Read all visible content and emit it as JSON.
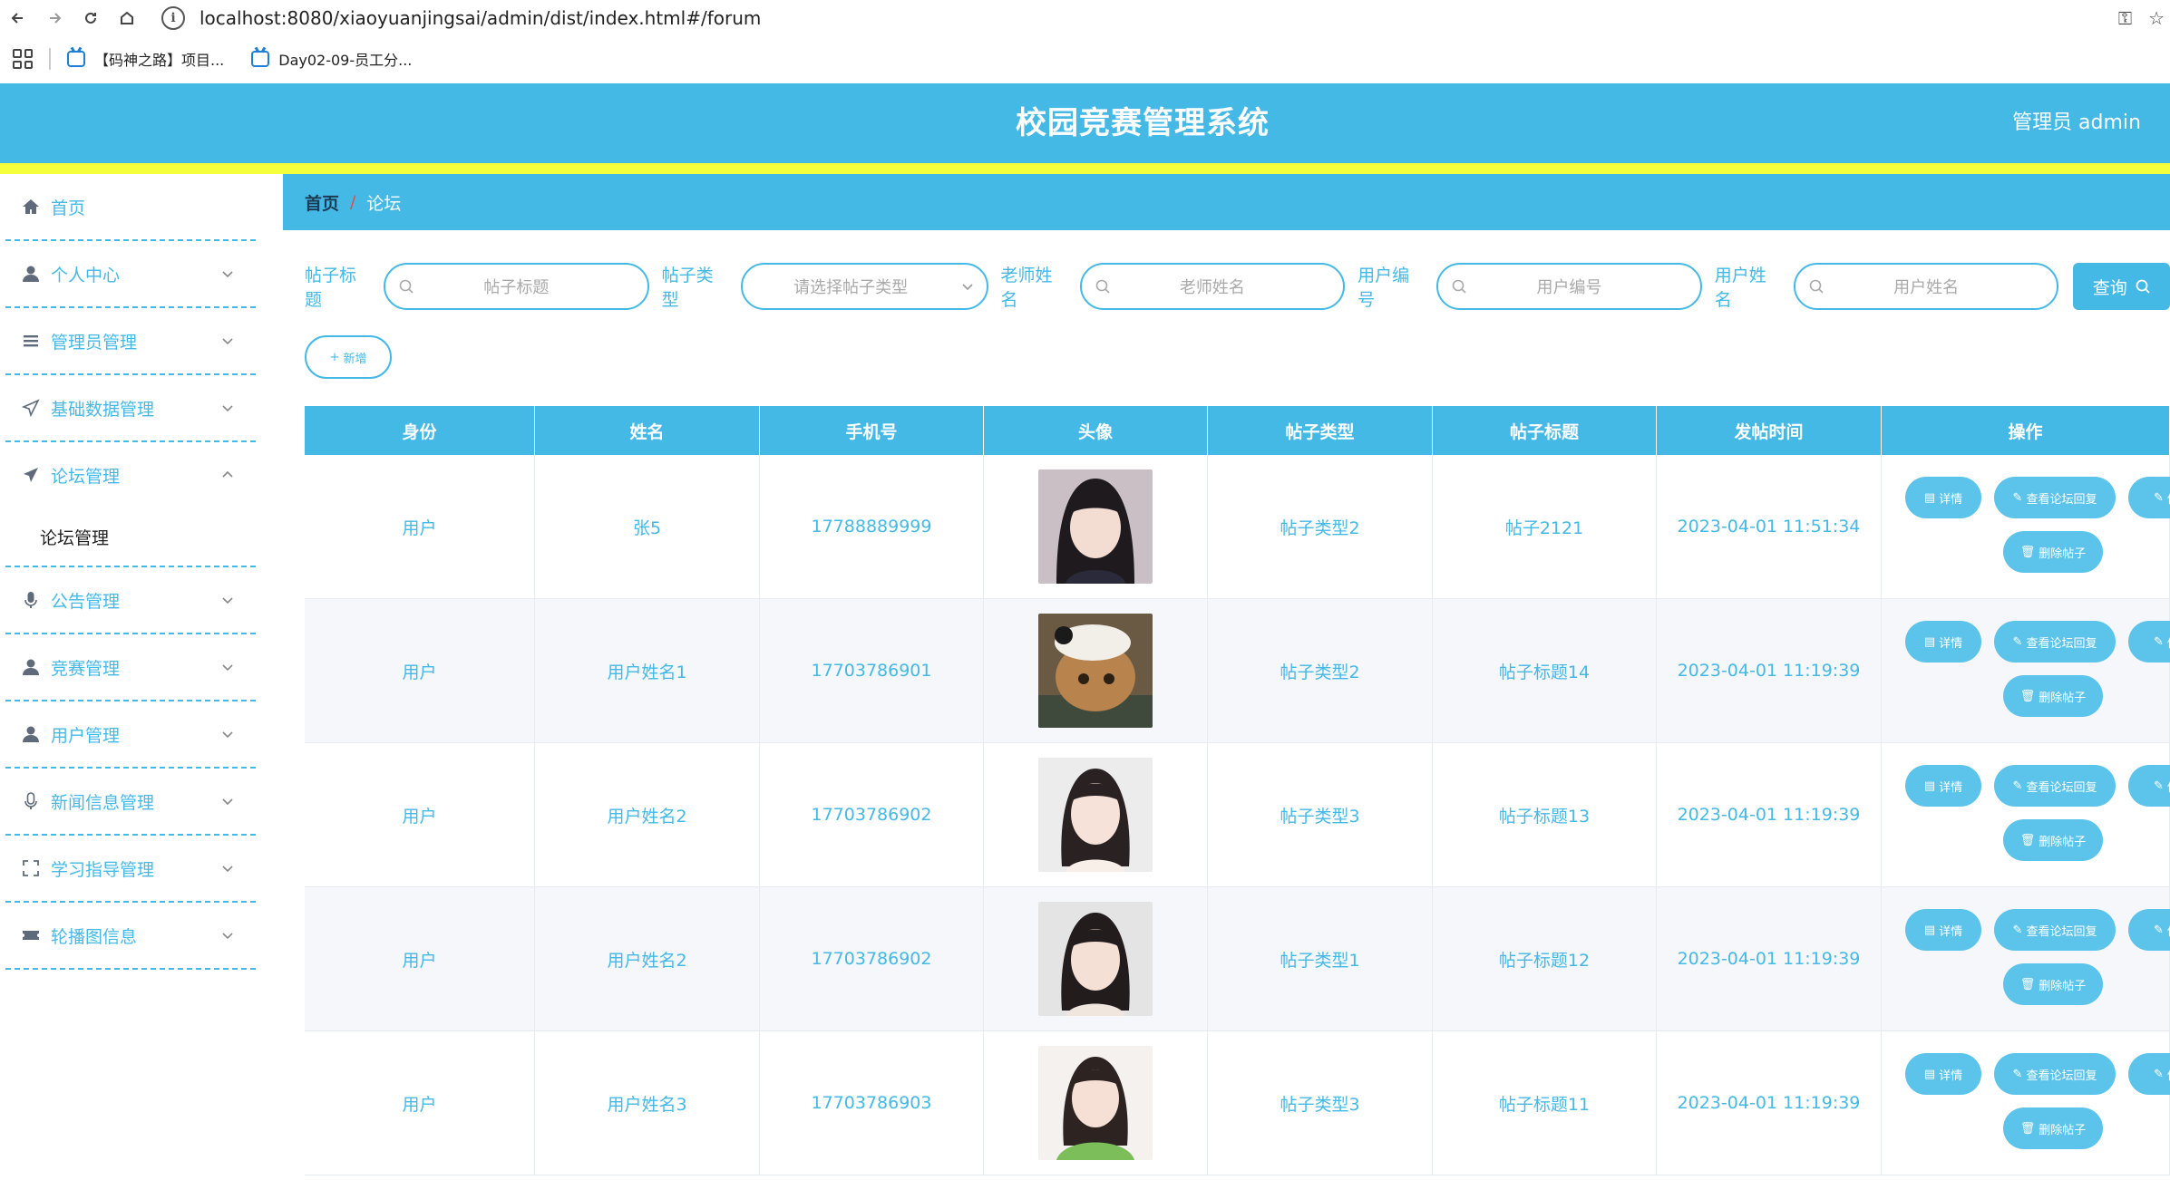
{
  "browser": {
    "url": "localhost:8080/xiaoyuanjingsai/admin/dist/index.html#/forum",
    "bookmarks": [
      "【码神之路】项目...",
      "Day02-09-员工分..."
    ]
  },
  "header": {
    "title": "校园竞赛管理系统",
    "user": "管理员 admin"
  },
  "sidebar": {
    "items": [
      {
        "label": "首页",
        "icon": "home-icon"
      },
      {
        "label": "个人中心",
        "icon": "user-icon"
      },
      {
        "label": "管理员管理",
        "icon": "list-icon"
      },
      {
        "label": "基础数据管理",
        "icon": "send-icon"
      },
      {
        "label": "论坛管理",
        "icon": "send-icon"
      },
      {
        "label": "公告管理",
        "icon": "mic-icon"
      },
      {
        "label": "竞赛管理",
        "icon": "user-icon"
      },
      {
        "label": "用户管理",
        "icon": "user-icon"
      },
      {
        "label": "新闻信息管理",
        "icon": "mic-icon"
      },
      {
        "label": "学习指导管理",
        "icon": "fullscreen-icon"
      },
      {
        "label": "轮播图信息",
        "icon": "ticket-icon"
      }
    ],
    "submenu": "论坛管理"
  },
  "breadcrumb": {
    "home": "首页",
    "sep": "/",
    "current": "论坛"
  },
  "search": {
    "title_label": "帖子标题",
    "title_placeholder": "帖子标题",
    "type_label": "帖子类型",
    "type_placeholder": "请选择帖子类型",
    "teacher_label": "老师姓名",
    "teacher_placeholder": "老师姓名",
    "userno_label": "用户编号",
    "userno_placeholder": "用户编号",
    "username_label": "用户姓名",
    "username_placeholder": "用户姓名",
    "button": "查询"
  },
  "add_button": "新增",
  "table": {
    "headers": [
      "身份",
      "姓名",
      "手机号",
      "头像",
      "帖子类型",
      "帖子标题",
      "发帖时间",
      "操作"
    ],
    "rows": [
      {
        "role": "用户",
        "name": "张5",
        "phone": "17788889999",
        "type": "帖子类型2",
        "title": "帖子2121",
        "time": "2023-04-01 11:51:34"
      },
      {
        "role": "用户",
        "name": "用户姓名1",
        "phone": "17703786901",
        "type": "帖子类型2",
        "title": "帖子标题14",
        "time": "2023-04-01 11:19:39"
      },
      {
        "role": "用户",
        "name": "用户姓名2",
        "phone": "17703786902",
        "type": "帖子类型3",
        "title": "帖子标题13",
        "time": "2023-04-01 11:19:39"
      },
      {
        "role": "用户",
        "name": "用户姓名2",
        "phone": "17703786902",
        "type": "帖子类型1",
        "title": "帖子标题12",
        "time": "2023-04-01 11:19:39"
      },
      {
        "role": "用户",
        "name": "用户姓名3",
        "phone": "17703786903",
        "type": "帖子类型3",
        "title": "帖子标题11",
        "time": "2023-04-01 11:19:39"
      }
    ],
    "actions": {
      "detail": "详情",
      "reply": "查看论坛回复",
      "edit": "修",
      "delete": "删除帖子"
    }
  },
  "colors": {
    "primary": "#45b9e6",
    "accent_bar": "#f6ff3c",
    "button": "#5cc4ea"
  }
}
